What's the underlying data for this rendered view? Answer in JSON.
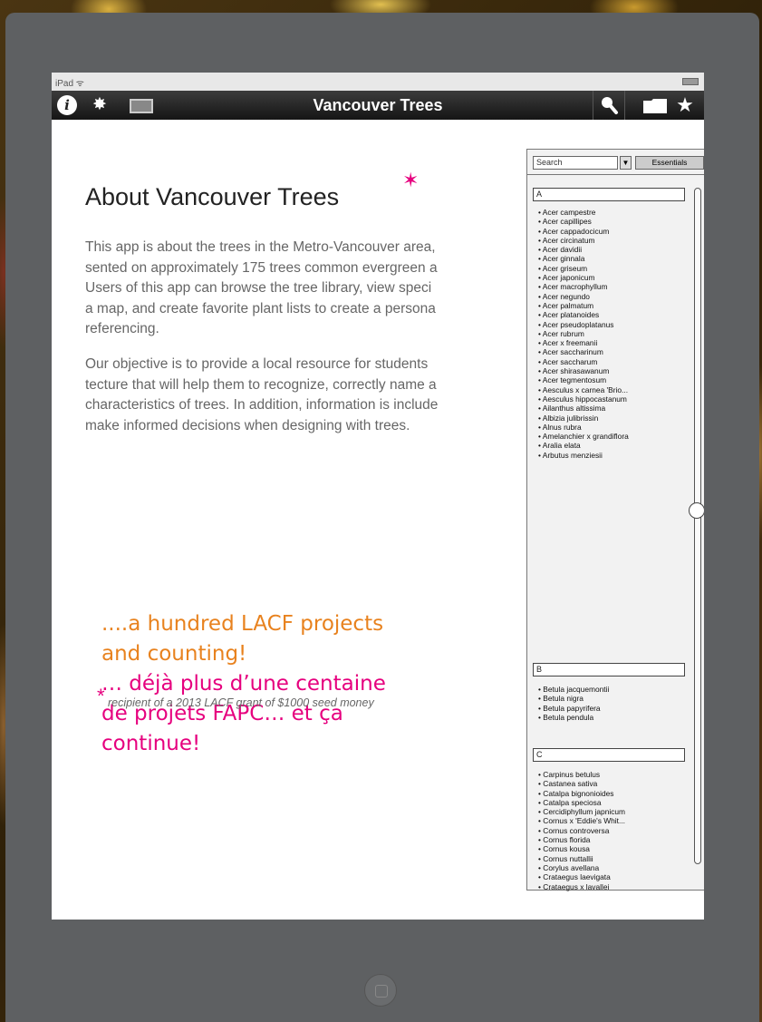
{
  "status_bar": {
    "left_text": "iPad ᯤ"
  },
  "navbar": {
    "title": "Vancouver Trees",
    "icons": [
      "info-icon",
      "gear-icon",
      "image-icon",
      "search-icon",
      "folder-icon",
      "star-icon"
    ],
    "info_glyph": "i",
    "gear_glyph": "✸",
    "search_glyph": "🔍",
    "folder_glyph": "▬",
    "star_glyph": "★"
  },
  "about": {
    "title": "About Vancouver Trees",
    "paragraph1": [
      "This app is about the trees in the Metro-Vancouver area,",
      "sented on approximately 175 trees common evergreen a",
      "Users of this app can browse the tree library, view speci",
      "a map, and create favorite plant lists to create a persona",
      "referencing."
    ],
    "paragraph2": [
      "Our objective is to provide a local resource for students",
      "tecture that will help them to recognize, correctly name a",
      "characteristics of trees. In addition, information is include",
      "make informed decisions when designing with trees."
    ]
  },
  "side_panel": {
    "search_placeholder": "Search",
    "filter_label": "▼",
    "essentials_label": "Essentials",
    "sections": [
      {
        "header": "A",
        "items": [
          "Acer campestre",
          "Acer capillipes",
          "Acer cappadocicum",
          "Acer circinatum",
          "Acer davidii",
          "Acer ginnala",
          "Acer griseum",
          "Acer japonicum",
          "Acer macrophyllum",
          "Acer negundo",
          "Acer palmatum",
          "Acer platanoides",
          "Acer pseudoplatanus",
          "Acer rubrum",
          "Acer x freemanii",
          "Acer saccharinum",
          "Acer saccharum",
          "Acer shirasawanum",
          "Acer tegmentosum",
          "Aesculus x carnea 'Brio...",
          "Aesculus hippocastanum",
          "Ailanthus altissima",
          "Albizia julibrissin",
          "Alnus rubra",
          "Amelanchier x grandiflora",
          "Aralia elata",
          "Arbutus menziesii"
        ]
      },
      {
        "header": "B",
        "items": [
          "Betula jacquemontii",
          "Betula nigra",
          "Betula papyrifera",
          "Betula pendula"
        ]
      },
      {
        "header": "C",
        "items": [
          "Carpinus betulus",
          "Castanea sativa",
          "Catalpa bignonioides",
          "Catalpa speciosa",
          "Cercidiphyllum japnicum",
          "Cornus x 'Eddie's Whit...",
          "Cornus controversa",
          "Cornus florida",
          "Cornus kousa",
          "Cornus nuttallii",
          "Corylus avellana",
          "Crataegus laevigata",
          "Crataegus x lavallei"
        ]
      }
    ]
  },
  "promo": {
    "line1": "....a hundred LACF projects",
    "line2": "and counting!",
    "line3": "… déjà plus d’une centaine",
    "line4": "de projets FAPC… et ça",
    "line5": "continue!"
  },
  "footnote": {
    "star": "*",
    "text": "recipient of a 2013 LACF grant of $1000 seed money"
  },
  "colors": {
    "accent_magenta": "#e6007e",
    "accent_orange": "#e8821e",
    "ipad_frame": "#5e6062",
    "navbar": "#1e1e1e"
  }
}
